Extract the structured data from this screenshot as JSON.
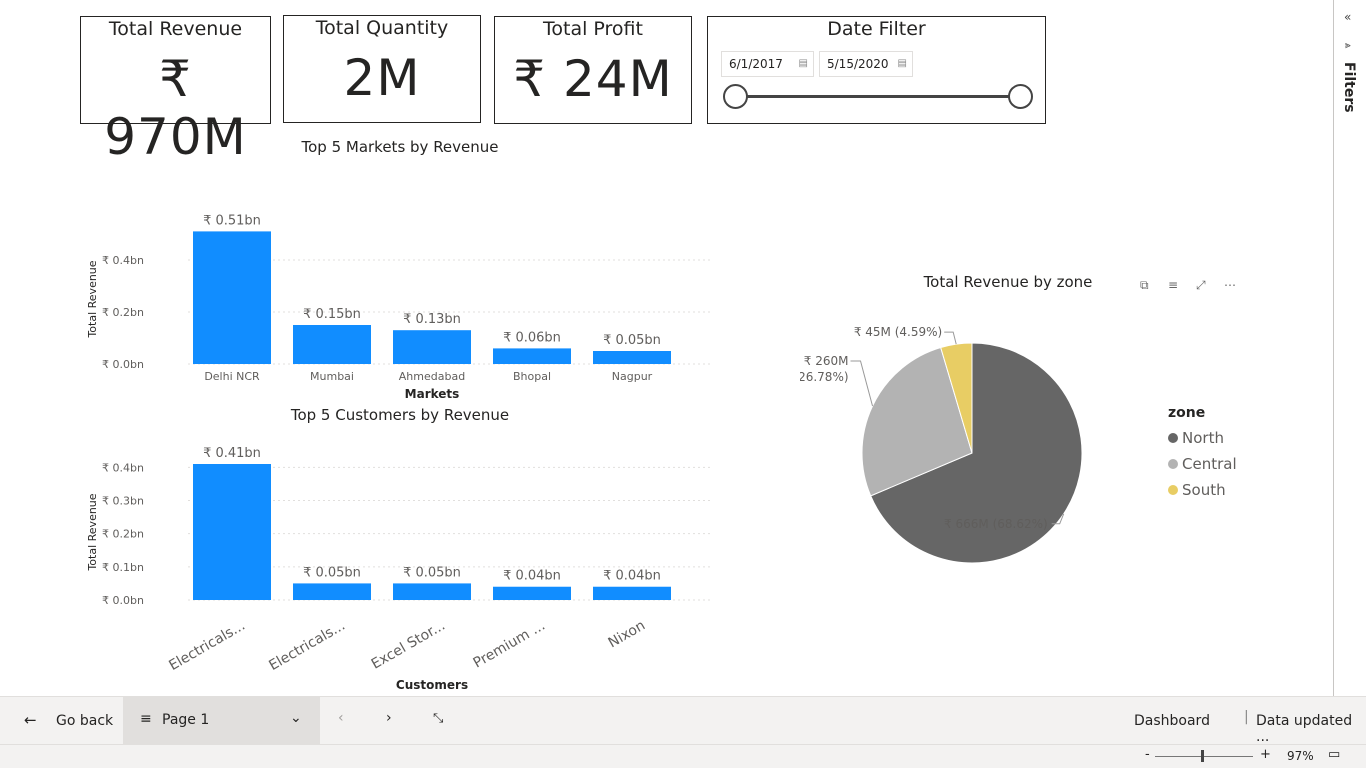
{
  "kpis": {
    "revenue": {
      "title": "Total Revenue",
      "value": "₹ 970M"
    },
    "quantity": {
      "title": "Total Quantity",
      "value": "2M"
    },
    "profit": {
      "title": "Total Profit",
      "value": "₹ 24M"
    }
  },
  "date_filter": {
    "title": "Date Filter",
    "start": "6/1/2017",
    "end": "5/15/2020"
  },
  "filters_pane": {
    "label": "Filters"
  },
  "pie_toolbar": {
    "icons": [
      "copy-icon",
      "filter-icon",
      "focus-mode-icon",
      "more-options-icon"
    ]
  },
  "colors": {
    "bar": "#118DFF",
    "north": "#666666",
    "central": "#B3B3B3",
    "south": "#E8CD64"
  },
  "chart_data": [
    {
      "type": "bar",
      "title": "Top 5 Markets by Revenue",
      "xlabel": "Markets",
      "ylabel": "Total Revenue",
      "categories": [
        "Delhi NCR",
        "Mumbai",
        "Ahmedabad",
        "Bhopal",
        "Nagpur"
      ],
      "values": [
        0.51,
        0.15,
        0.13,
        0.06,
        0.05
      ],
      "data_labels": [
        "₹ 0.51bn",
        "₹ 0.15bn",
        "₹ 0.13bn",
        "₹ 0.06bn",
        "₹ 0.05bn"
      ],
      "ylim": [
        0,
        0.5
      ],
      "yticks": [
        0,
        0.2,
        0.4
      ],
      "ytick_labels": [
        "₹ 0.0bn",
        "₹ 0.2bn",
        "₹ 0.4bn"
      ],
      "grid": true
    },
    {
      "type": "bar",
      "title": "Top 5 Customers by Revenue",
      "xlabel": "Customers",
      "ylabel": "Total Revenue",
      "categories": [
        "Electricals...",
        "Electricals...",
        "Excel Stor...",
        "Premium ...",
        "Nixon"
      ],
      "values": [
        0.41,
        0.05,
        0.05,
        0.04,
        0.04
      ],
      "data_labels": [
        "₹ 0.41bn",
        "₹ 0.05bn",
        "₹ 0.05bn",
        "₹ 0.04bn",
        "₹ 0.04bn"
      ],
      "ylim": [
        0,
        0.41
      ],
      "yticks": [
        0,
        0.1,
        0.2,
        0.3,
        0.4
      ],
      "ytick_labels": [
        "₹ 0.0bn",
        "₹ 0.1bn",
        "₹ 0.2bn",
        "₹ 0.3bn",
        "₹ 0.4bn"
      ],
      "grid": true
    },
    {
      "type": "pie",
      "title": "Total Revenue by zone",
      "legend_title": "zone",
      "legend_position": "right",
      "categories": [
        "North",
        "Central",
        "South"
      ],
      "values": [
        68.62,
        26.78,
        4.59
      ],
      "labels": [
        "₹ 666M (68.62%)",
        "₹ 260M (26.78%)",
        "₹ 45M (4.59%)"
      ]
    }
  ],
  "bottom_bar": {
    "go_back": "Go back",
    "page": "Page 1",
    "dashboard": "Dashboard",
    "data_updated": "Data updated ...",
    "zoom": "97%"
  }
}
